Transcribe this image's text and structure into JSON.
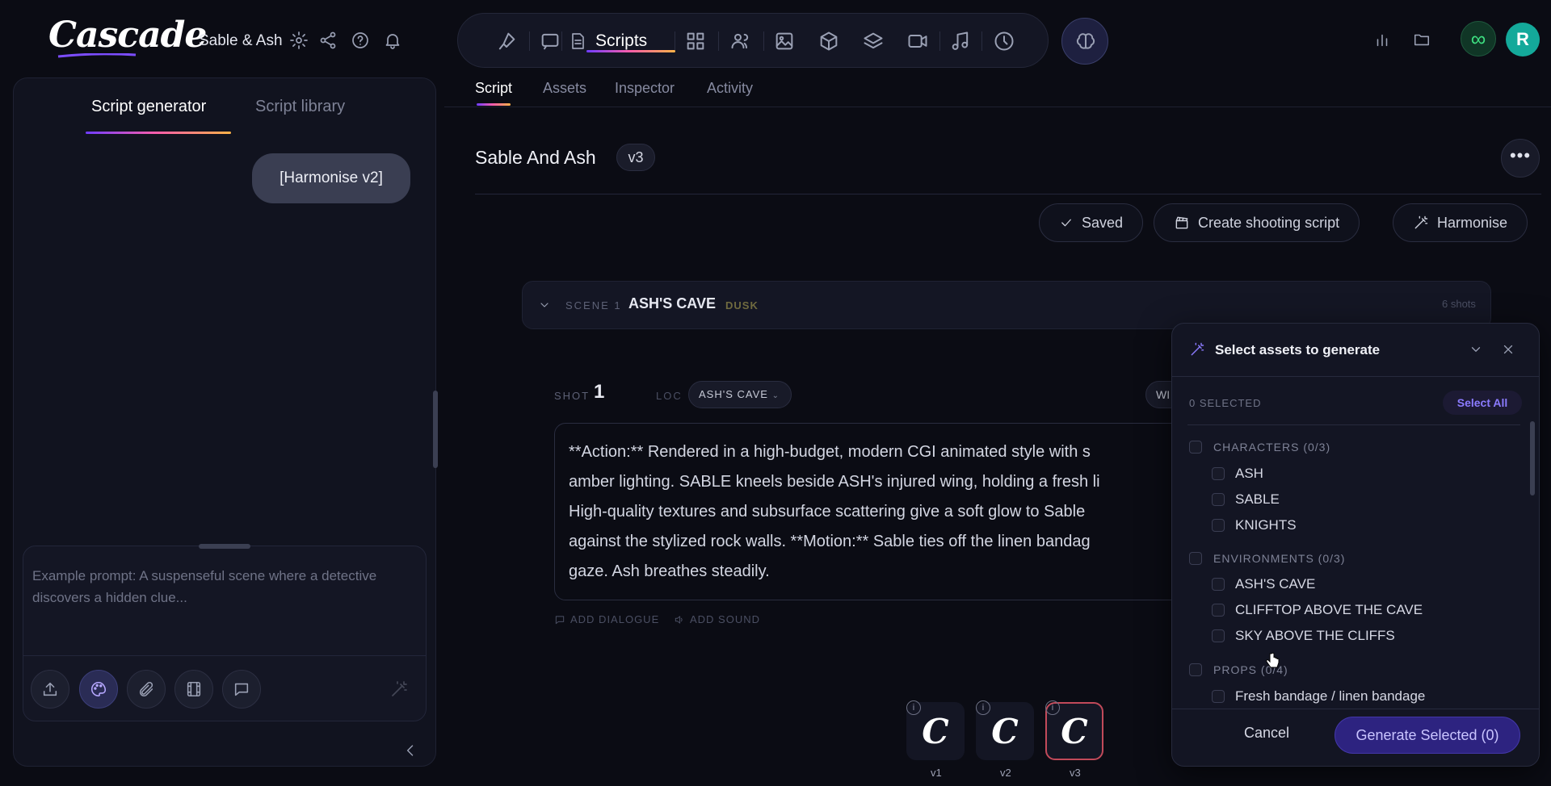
{
  "app": {
    "logo": "Cascade",
    "project_name": "Sable & Ash"
  },
  "nav": {
    "active_label": "Scripts"
  },
  "account": {
    "avatar_initial": "R",
    "infinity_symbol": "∞"
  },
  "left_panel": {
    "tabs": [
      {
        "label": "Script generator",
        "active": true
      },
      {
        "label": "Script library",
        "active": false
      }
    ],
    "message": "[Harmonise v2]",
    "prompt_placeholder": "Example prompt: A suspenseful scene where a detective discovers a hidden clue..."
  },
  "main": {
    "sub_tabs": [
      {
        "label": "Script",
        "active": true
      },
      {
        "label": "Assets"
      },
      {
        "label": "Inspector"
      },
      {
        "label": "Activity"
      }
    ],
    "title": "Sable And Ash",
    "version": "v3",
    "actions": {
      "saved": "Saved",
      "create_shooting": "Create shooting script",
      "harmonise": "Harmonise"
    },
    "more": "•••"
  },
  "scene": {
    "label": "SCENE 1",
    "name": "ASH'S CAVE",
    "time": "DUSK",
    "shots": "6 shots"
  },
  "shot": {
    "label": "SHOT",
    "number": "1",
    "loc_label": "LOC",
    "location": "ASH'S CAVE",
    "extra_chip": "WI",
    "text_lines": [
      "**Action:** Rendered in a high-budget, modern CGI animated style with s",
      "amber lighting. SABLE kneels beside ASH's injured wing, holding a fresh li",
      "High-quality textures and subsurface scattering give a soft glow to Sable",
      "against the stylized rock walls. **Motion:** Sable ties off the linen bandag",
      "gaze. Ash breathes steadily."
    ],
    "add_dialogue": "ADD DIALOGUE",
    "add_sound": "ADD SOUND"
  },
  "versions": [
    {
      "label": "v1",
      "glyph": "C"
    },
    {
      "label": "v2",
      "glyph": "C"
    },
    {
      "label": "v3",
      "glyph": "C",
      "active": true
    }
  ],
  "modal": {
    "title": "Select assets to generate",
    "selected": "0 SELECTED",
    "select_all": "Select All",
    "groups": {
      "characters": {
        "label": "CHARACTERS (0/3)",
        "items": [
          "ASH",
          "SABLE",
          "KNIGHTS"
        ]
      },
      "environments": {
        "label": "ENVIRONMENTS (0/3)",
        "items": [
          "ASH'S CAVE",
          "CLIFFTOP ABOVE THE CAVE",
          "SKY ABOVE THE CLIFFS"
        ]
      },
      "props": {
        "label": "PROPS (0/4)",
        "items": [
          "Fresh bandage / linen bandage"
        ]
      }
    },
    "cancel": "Cancel",
    "generate": "Generate Selected (0)"
  },
  "colors": {
    "accent": "#6f3cff",
    "gradient_pink": "#ff5fa8",
    "gradient_orange": "#ffb347",
    "primary_button": "#2d2380",
    "avatar": "#14a99a"
  }
}
